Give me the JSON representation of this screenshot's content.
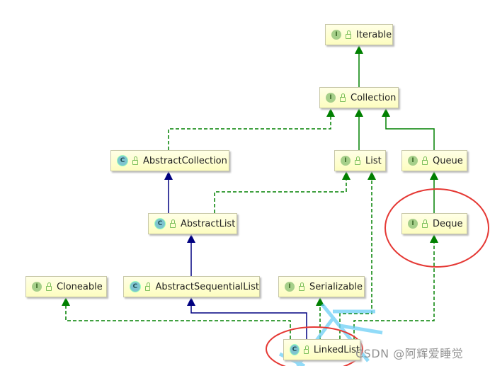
{
  "nodes": [
    {
      "id": "iterable",
      "kind": "I",
      "label": "Iterable"
    },
    {
      "id": "collection",
      "kind": "I",
      "label": "Collection"
    },
    {
      "id": "abstract-collection",
      "kind": "C",
      "label": "AbstractCollection"
    },
    {
      "id": "list",
      "kind": "I",
      "label": "List"
    },
    {
      "id": "queue",
      "kind": "I",
      "label": "Queue"
    },
    {
      "id": "abstract-list",
      "kind": "C",
      "label": "AbstractList"
    },
    {
      "id": "deque",
      "kind": "I",
      "label": "Deque"
    },
    {
      "id": "cloneable",
      "kind": "I",
      "label": "Cloneable"
    },
    {
      "id": "abstract-sequential-list",
      "kind": "C",
      "label": "AbstractSequentialList"
    },
    {
      "id": "serializable",
      "kind": "I",
      "label": "Serializable"
    },
    {
      "id": "linked-list",
      "kind": "C",
      "label": "LinkedList"
    }
  ],
  "edges": [
    {
      "from": "collection",
      "to": "iterable",
      "type": "extends-interface"
    },
    {
      "from": "list",
      "to": "collection",
      "type": "extends-interface"
    },
    {
      "from": "queue",
      "to": "collection",
      "type": "extends-interface"
    },
    {
      "from": "abstract-collection",
      "to": "collection",
      "type": "implements"
    },
    {
      "from": "abstract-list",
      "to": "abstract-collection",
      "type": "extends-class"
    },
    {
      "from": "abstract-list",
      "to": "list",
      "type": "implements"
    },
    {
      "from": "deque",
      "to": "queue",
      "type": "extends-interface"
    },
    {
      "from": "abstract-sequential-list",
      "to": "abstract-list",
      "type": "extends-class"
    },
    {
      "from": "linked-list",
      "to": "abstract-sequential-list",
      "type": "extends-class"
    },
    {
      "from": "linked-list",
      "to": "cloneable",
      "type": "implements"
    },
    {
      "from": "linked-list",
      "to": "serializable",
      "type": "implements"
    },
    {
      "from": "linked-list",
      "to": "list",
      "type": "implements"
    },
    {
      "from": "linked-list",
      "to": "deque",
      "type": "implements"
    }
  ],
  "highlights": [
    "deque",
    "linked-list"
  ],
  "colors": {
    "interface_edge": "#008000",
    "class_edge": "#000080",
    "highlight": "#e53935"
  },
  "watermark": "CSDN @阿辉爱睡觉"
}
